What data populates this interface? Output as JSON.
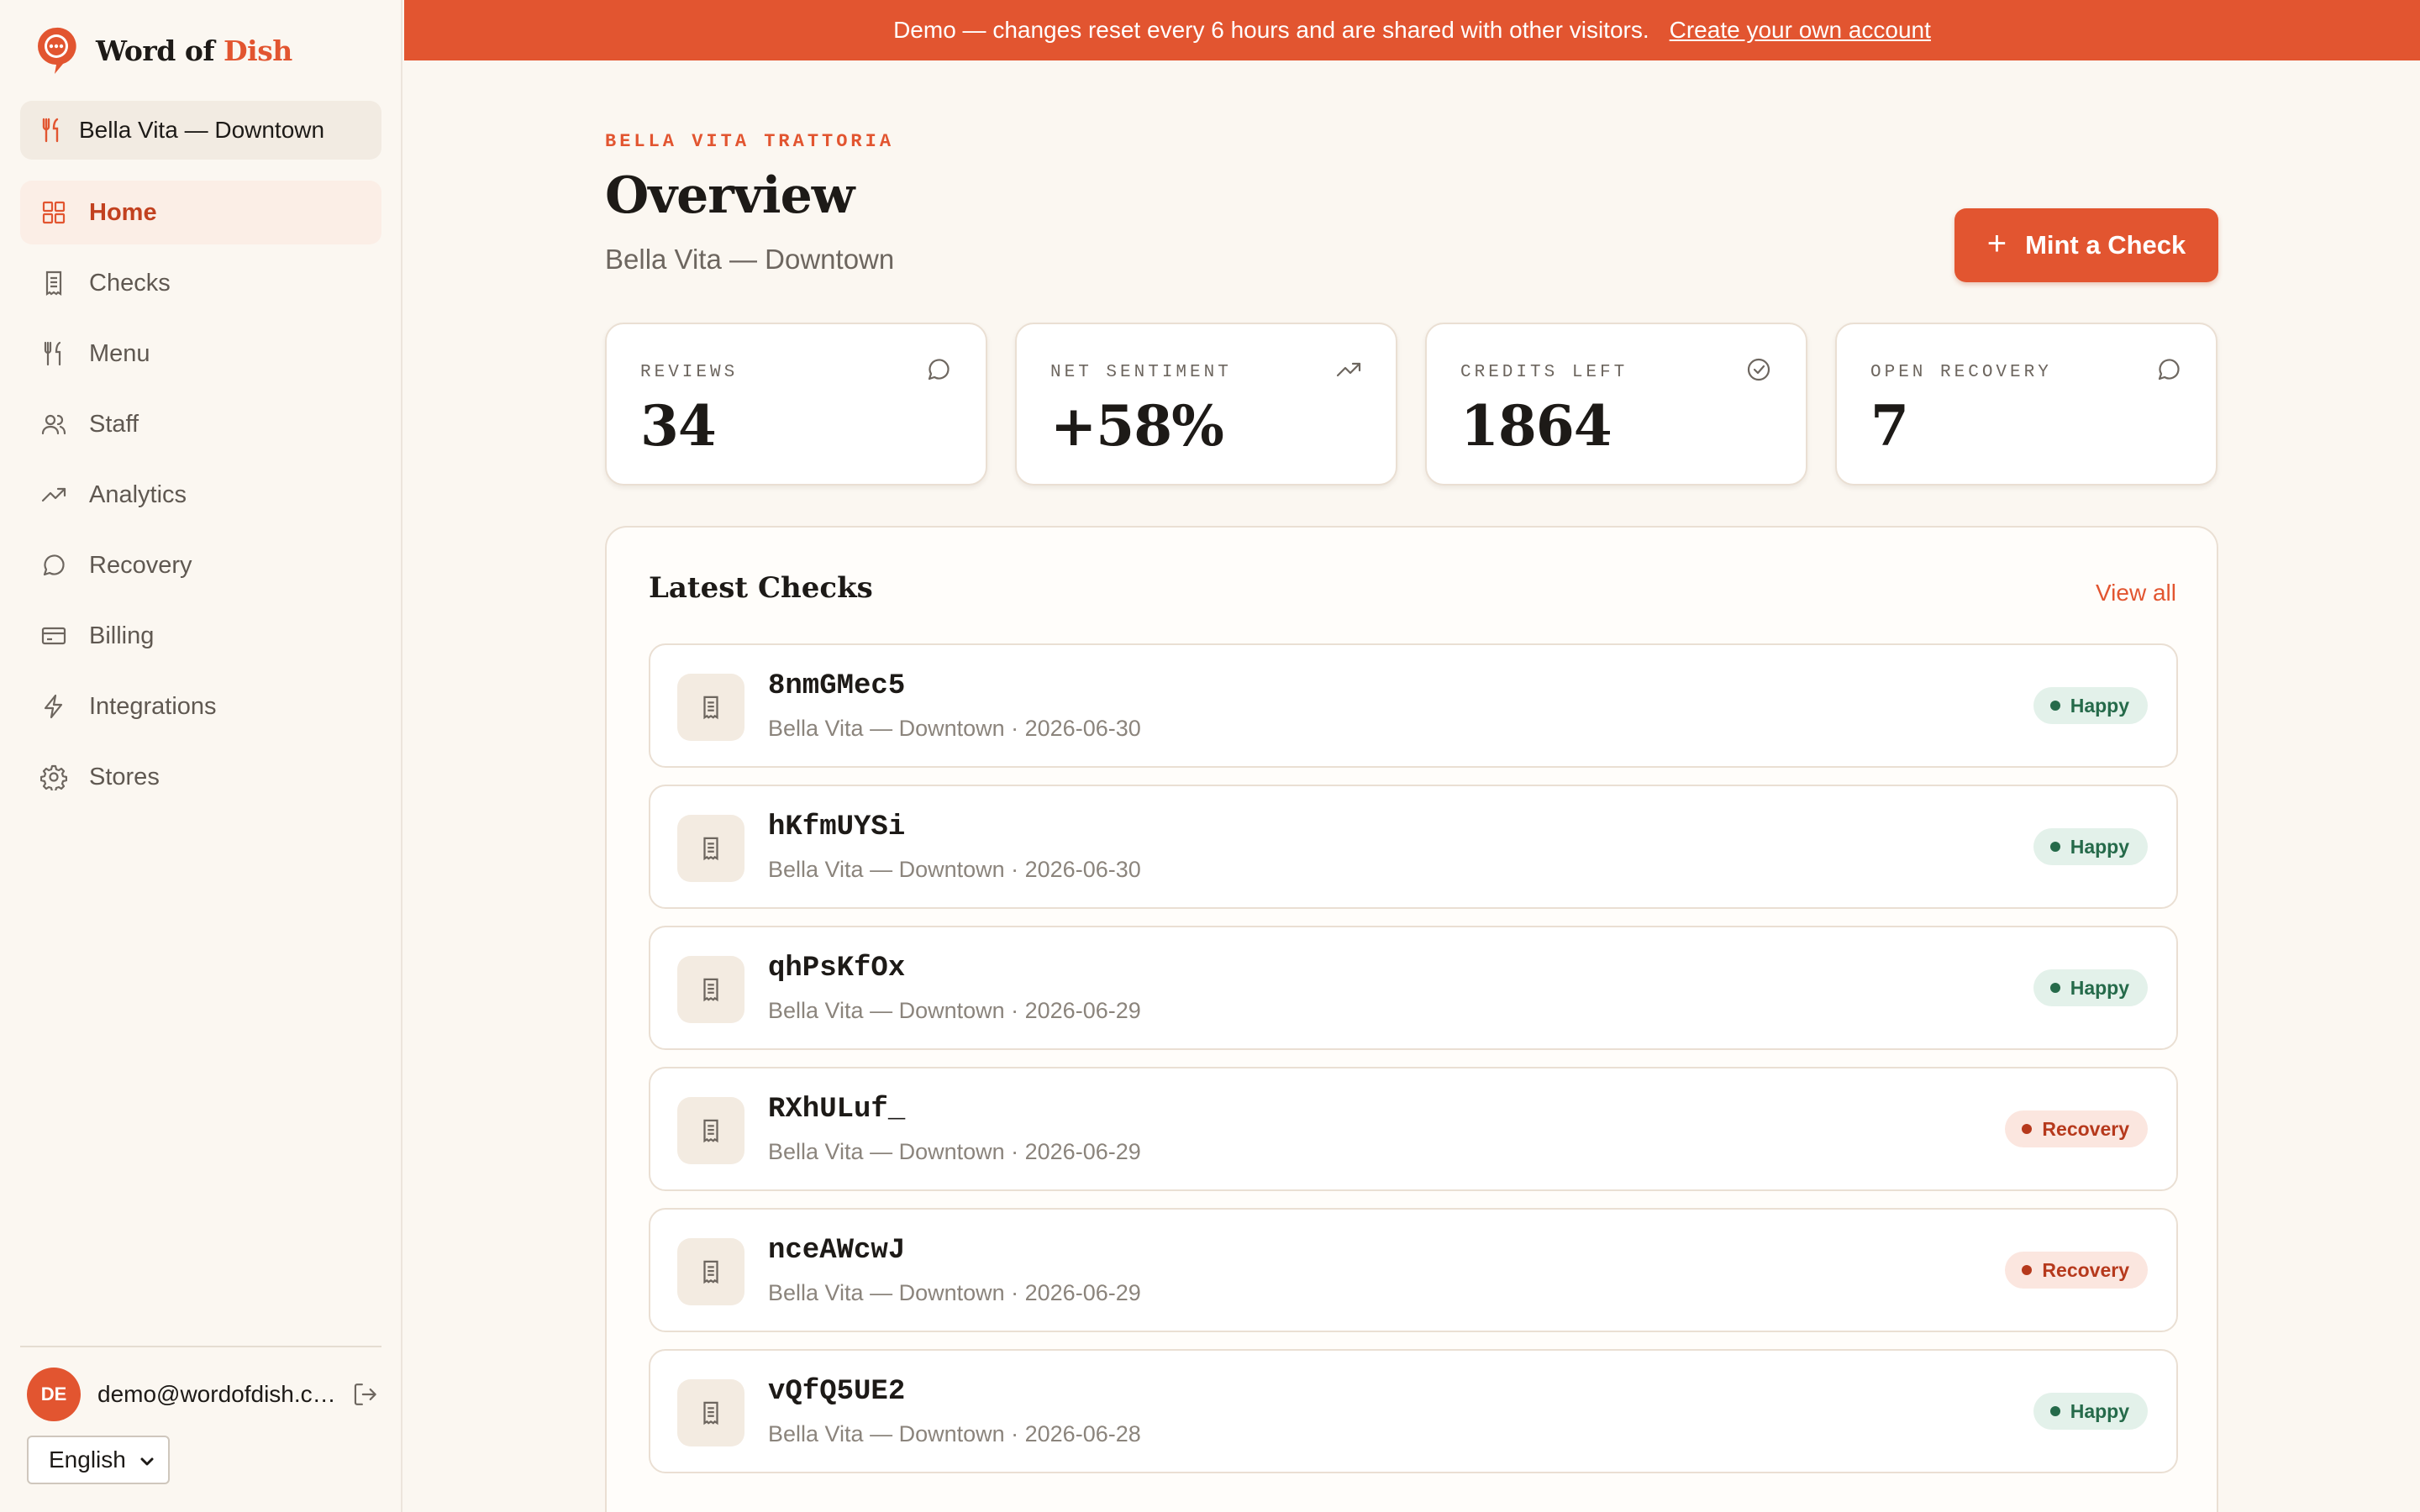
{
  "brand": {
    "name_part1": "Word of",
    "name_part2": "Dish"
  },
  "store_switcher": {
    "label": "Bella Vita — Downtown"
  },
  "nav": [
    {
      "label": "Home",
      "icon": "grid-icon",
      "active": true
    },
    {
      "label": "Checks",
      "icon": "receipt-icon",
      "active": false
    },
    {
      "label": "Menu",
      "icon": "utensils-icon",
      "active": false
    },
    {
      "label": "Staff",
      "icon": "users-icon",
      "active": false
    },
    {
      "label": "Analytics",
      "icon": "trending-up-icon",
      "active": false
    },
    {
      "label": "Recovery",
      "icon": "message-circle-icon",
      "active": false
    },
    {
      "label": "Billing",
      "icon": "credit-card-icon",
      "active": false
    },
    {
      "label": "Integrations",
      "icon": "lightning-icon",
      "active": false
    },
    {
      "label": "Stores",
      "icon": "gear-icon",
      "active": false
    }
  ],
  "user": {
    "initials": "DE",
    "email": "demo@wordofdish.com"
  },
  "language": {
    "selected": "English"
  },
  "banner": {
    "text": "Demo — changes reset every 6 hours and are shared with other visitors.",
    "link": "Create your own account"
  },
  "header": {
    "eyebrow": "BELLA VITA TRATTORIA",
    "title": "Overview",
    "subtitle": "Bella Vita — Downtown",
    "mint_button": "Mint a Check"
  },
  "stats": [
    {
      "label": "REVIEWS",
      "value": "34",
      "icon": "message-circle-icon"
    },
    {
      "label": "NET SENTIMENT",
      "value": "+58%",
      "icon": "trending-up-icon"
    },
    {
      "label": "CREDITS LEFT",
      "value": "1864",
      "icon": "check-circle-icon"
    },
    {
      "label": "OPEN RECOVERY",
      "value": "7",
      "icon": "message-circle-icon"
    }
  ],
  "latest_checks": {
    "title": "Latest Checks",
    "view_all": "View all",
    "rows": [
      {
        "code": "8nmGMec5",
        "meta": "Bella Vita — Downtown · 2026-06-30",
        "status": "Happy"
      },
      {
        "code": "hKfmUYSi",
        "meta": "Bella Vita — Downtown · 2026-06-30",
        "status": "Happy"
      },
      {
        "code": "qhPsKfOx",
        "meta": "Bella Vita — Downtown · 2026-06-29",
        "status": "Happy"
      },
      {
        "code": "RXhULuf_",
        "meta": "Bella Vita — Downtown · 2026-06-29",
        "status": "Recovery"
      },
      {
        "code": "nceAWcwJ",
        "meta": "Bella Vita — Downtown · 2026-06-29",
        "status": "Recovery"
      },
      {
        "code": "vQfQ5UE2",
        "meta": "Bella Vita — Downtown · 2026-06-28",
        "status": "Happy"
      }
    ]
  },
  "colors": {
    "accent": "#e25530",
    "background": "#fbf7f1",
    "happy": "#256a4a",
    "recovery": "#b6391c"
  }
}
